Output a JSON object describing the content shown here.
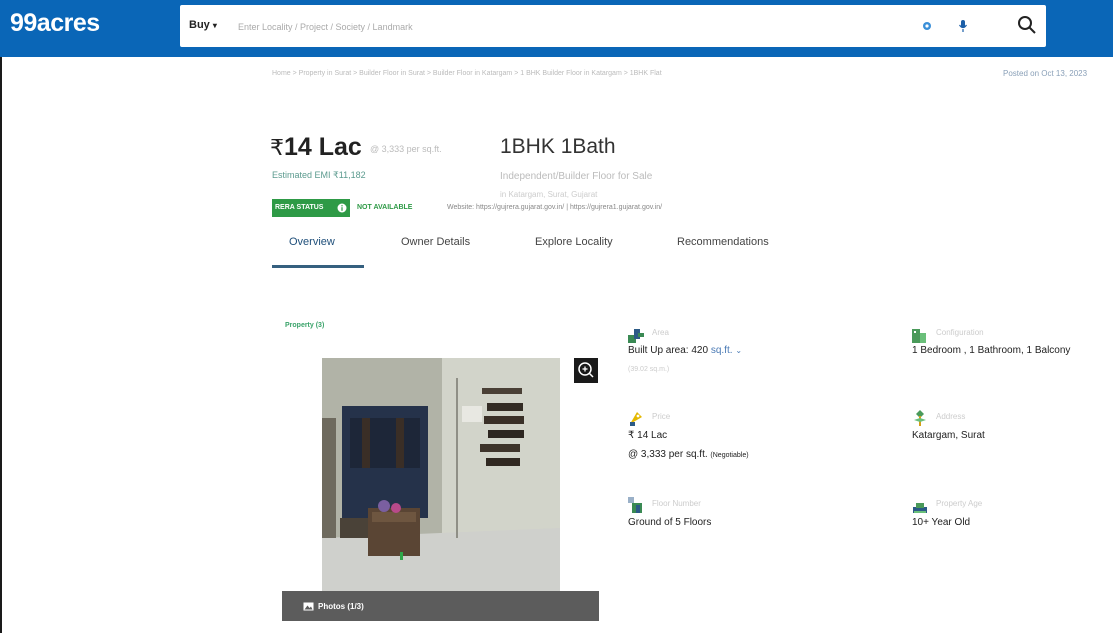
{
  "header": {
    "logo": "99acres",
    "buy_label": "Buy",
    "search_placeholder": "Enter Locality / Project / Society / Landmark"
  },
  "breadcrumb": "Home > Property in Surat > Builder Floor in Surat > Builder Floor in Katargam > 1 BHK Builder Floor in Katargam > 1BHK Flat",
  "posted": "Posted on Oct 13, 2023",
  "listing": {
    "price_symbol": "₹",
    "price": "14 Lac",
    "per_sqft": "@ 3,333 per sq.ft.",
    "emi": "Estimated EMI ₹11,182",
    "title": "1BHK 1Bath",
    "subtitle": "Independent/Builder Floor for Sale",
    "locality": "in Katargam, Surat, Gujarat"
  },
  "rera": {
    "badge": "RERA STATUS",
    "status": "NOT AVAILABLE",
    "website": "Website: https://gujrera.gujarat.gov.in/ | https://gujrera1.gujarat.gov.in/"
  },
  "tabs": [
    {
      "label": "Overview"
    },
    {
      "label": "Owner Details"
    },
    {
      "label": "Explore Locality"
    },
    {
      "label": "Recommendations"
    }
  ],
  "gallery": {
    "label": "Property (3)",
    "photos_label": "Photos (1/3)"
  },
  "details": {
    "area": {
      "label": "Area",
      "value": "Built Up area: 420",
      "unit": "sq.ft.",
      "sub": "(39.02 sq.m.)"
    },
    "configuration": {
      "label": "Configuration",
      "value": "1 Bedroom , 1 Bathroom, 1 Balcony"
    },
    "price": {
      "label": "Price",
      "value": "₹ 14 Lac",
      "per": "@ 3,333 per sq.ft.",
      "negotiable": "(Negotiable)"
    },
    "address": {
      "label": "Address",
      "value": "Katargam, Surat"
    },
    "floor": {
      "label": "Floor Number",
      "value": "Ground of 5 Floors"
    },
    "age": {
      "label": "Property Age",
      "value": "10+ Year Old"
    }
  },
  "colors": {
    "header": "#0a66b7",
    "rera_green": "#2e9a46",
    "tab_active": "#35607f"
  }
}
